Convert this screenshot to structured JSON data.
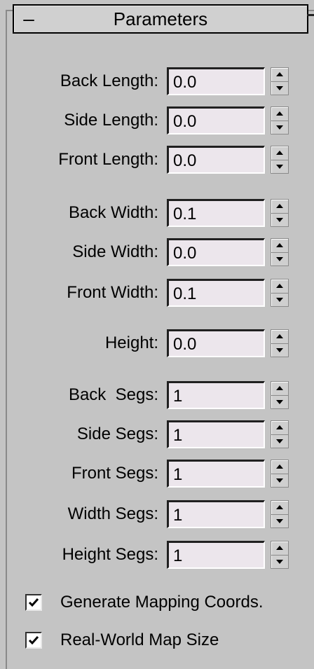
{
  "rollout": {
    "toggle": "–",
    "title": "Parameters"
  },
  "fields": [
    {
      "label": "Back Length:",
      "value": "0.0"
    },
    {
      "label": "Side Length:",
      "value": "0.0"
    },
    {
      "label": "Front Length:",
      "value": "0.0"
    },
    {
      "label": "Back Width:",
      "value": "0.1"
    },
    {
      "label": "Side Width:",
      "value": "0.0"
    },
    {
      "label": "Front Width:",
      "value": "0.1"
    },
    {
      "label": "Height:",
      "value": "0.0"
    },
    {
      "label": "Back  Segs:",
      "value": "1"
    },
    {
      "label": "Side Segs:",
      "value": "1"
    },
    {
      "label": "Front Segs:",
      "value": "1"
    },
    {
      "label": "Width Segs:",
      "value": "1"
    },
    {
      "label": "Height Segs:",
      "value": "1"
    }
  ],
  "checkboxes": [
    {
      "label": "Generate Mapping Coords.",
      "checked": true
    },
    {
      "label": "Real-World Map Size",
      "checked": true
    }
  ],
  "icons": {
    "spinner_up": "triangle-up-icon",
    "spinner_down": "triangle-down-icon",
    "check": "checkmark-icon"
  }
}
